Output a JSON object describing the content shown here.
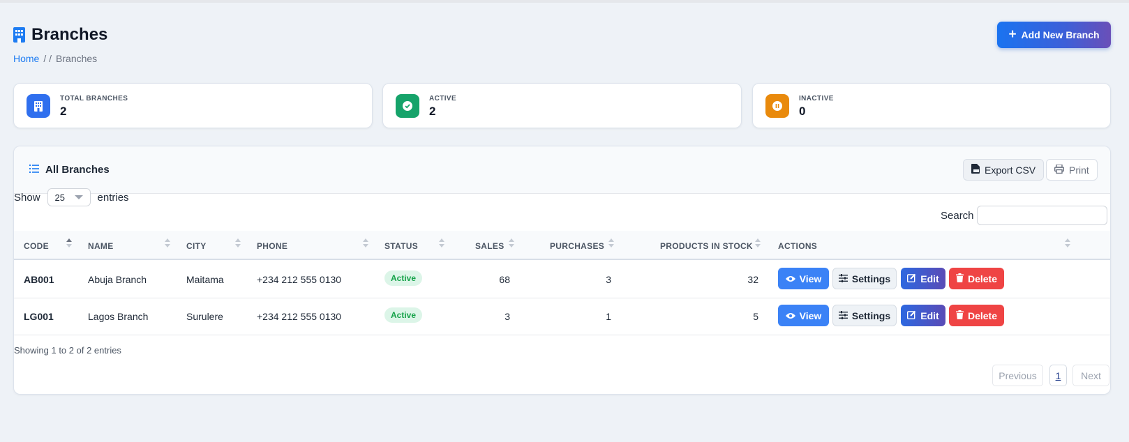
{
  "header": {
    "title": "Branches",
    "breadcrumb": {
      "home": "Home",
      "sep": "/ /",
      "current": "Branches"
    },
    "add_button": "Add New Branch"
  },
  "stats": [
    {
      "label": "TOTAL BRANCHES",
      "value": "2",
      "color": "#2f6fee",
      "icon": "building-icon"
    },
    {
      "label": "ACTIVE",
      "value": "2",
      "color": "#16a36a",
      "icon": "check-circle-icon"
    },
    {
      "label": "INACTIVE",
      "value": "0",
      "color": "#e98a0c",
      "icon": "pause-circle-icon"
    }
  ],
  "card": {
    "title": "All Branches",
    "export_csv": "Export CSV",
    "print": "Print",
    "show_label": "Show",
    "entries_value": "25",
    "entries_label": "entries",
    "search_label": "Search",
    "search_value": ""
  },
  "table": {
    "columns": [
      "CODE",
      "NAME",
      "CITY",
      "PHONE",
      "STATUS",
      "SALES",
      "PURCHASES",
      "PRODUCTS IN STOCK",
      "ACTIONS"
    ],
    "rows": [
      {
        "code": "AB001",
        "name": "Abuja Branch",
        "city": "Maitama",
        "phone": "+234 212 555 0130",
        "status": "Active",
        "sales": "68",
        "purchases": "3",
        "stock": "32"
      },
      {
        "code": "LG001",
        "name": "Lagos Branch",
        "city": "Surulere",
        "phone": "+234 212 555 0130",
        "status": "Active",
        "sales": "3",
        "purchases": "1",
        "stock": "5"
      }
    ],
    "actions": {
      "view": "View",
      "settings": "Settings",
      "edit": "Edit",
      "delete": "Delete"
    }
  },
  "footer": {
    "showing": "Showing 1 to 2 of 2 entries",
    "previous": "Previous",
    "page": "1",
    "next": "Next"
  }
}
